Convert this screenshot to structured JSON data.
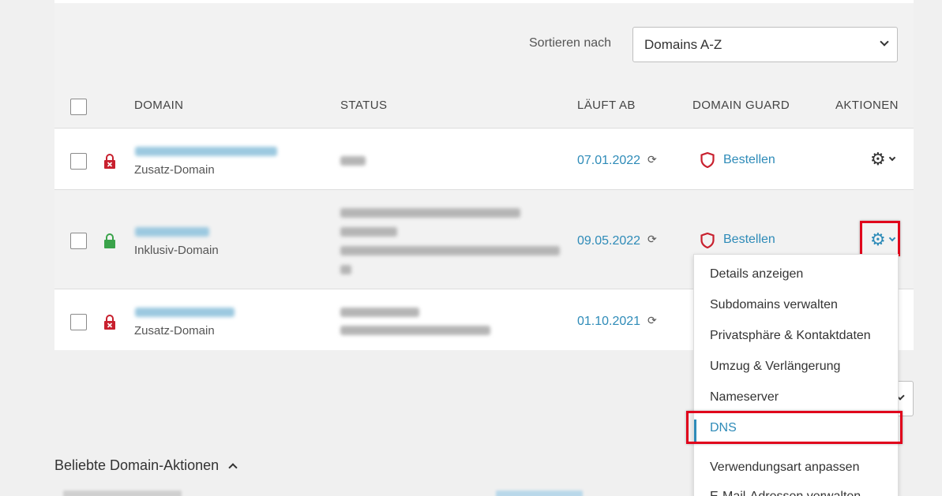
{
  "sort": {
    "label": "Sortieren nach",
    "selected": "Domains A-Z"
  },
  "table": {
    "headers": {
      "domain": "DOMAIN",
      "status": "STATUS",
      "expires": "LÄUFT AB",
      "guard": "DOMAIN GUARD",
      "actions": "AKTIONEN"
    },
    "rows": [
      {
        "domain_type": "Zusatz-Domain",
        "expires": "07.01.2022",
        "guard_action": "Bestellen",
        "lock": "locked-red"
      },
      {
        "domain_type": "Inklusiv-Domain",
        "expires": "09.05.2022",
        "guard_action": "Bestellen",
        "lock": "unlocked-green"
      },
      {
        "domain_type": "Zusatz-Domain",
        "expires": "01.10.2021",
        "guard_action": "",
        "lock": "locked-red"
      }
    ]
  },
  "actions_menu": {
    "items": [
      "Details anzeigen",
      "Subdomains verwalten",
      "Privatsphäre & Kontaktdaten",
      "Umzug & Verlängerung",
      "Nameserver",
      "DNS",
      "Verwendungsart anpassen",
      "E-Mail-Adressen verwalten"
    ],
    "active_index": 5
  },
  "popular_actions": {
    "title": "Beliebte Domain-Aktionen"
  },
  "colors": {
    "link": "#2e8bb8",
    "danger": "#c8202e",
    "success": "#3aa34a",
    "highlight": "#e0001b"
  }
}
